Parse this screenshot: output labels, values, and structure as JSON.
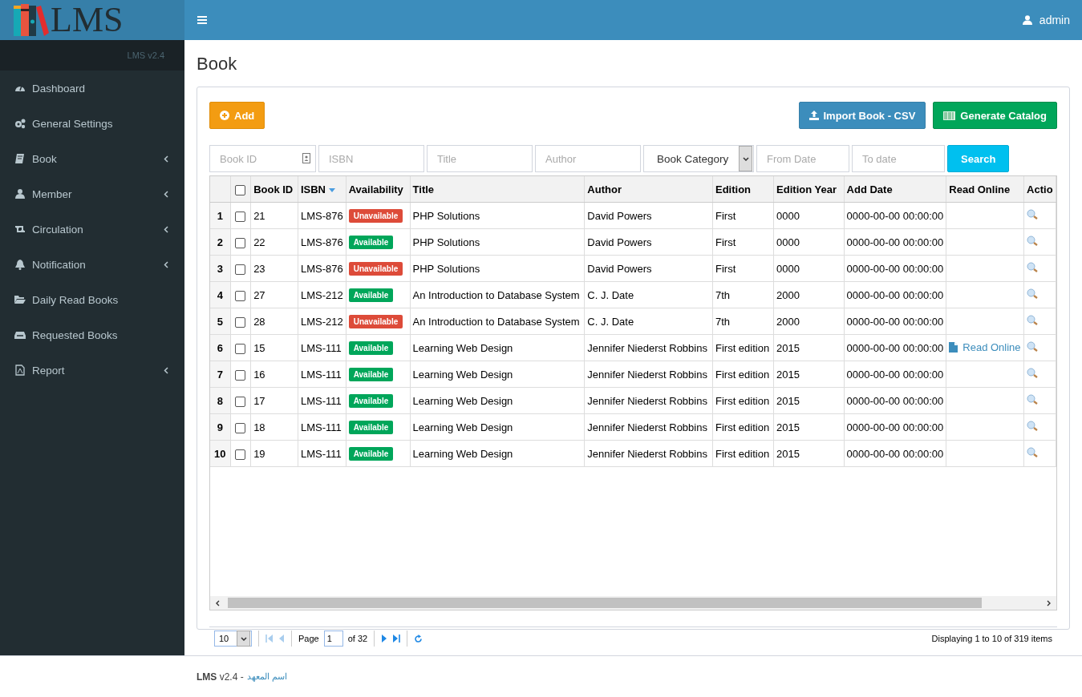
{
  "logo": {
    "text": "LMS"
  },
  "sidebar": {
    "version": "LMS v2.4",
    "items": [
      {
        "label": "Dashboard",
        "has_submenu": false
      },
      {
        "label": "General Settings",
        "has_submenu": false
      },
      {
        "label": "Book",
        "has_submenu": true
      },
      {
        "label": "Member",
        "has_submenu": true
      },
      {
        "label": "Circulation",
        "has_submenu": true
      },
      {
        "label": "Notification",
        "has_submenu": true
      },
      {
        "label": "Daily Read Books",
        "has_submenu": false
      },
      {
        "label": "Requested Books",
        "has_submenu": false
      },
      {
        "label": "Report",
        "has_submenu": true
      }
    ]
  },
  "header": {
    "user": "admin"
  },
  "page_title": "Book",
  "toolbar": {
    "add": "Add",
    "import": "Import Book - CSV",
    "catalog": "Generate Catalog"
  },
  "filters": {
    "book_id": {
      "placeholder": "Book ID"
    },
    "isbn": {
      "placeholder": "ISBN"
    },
    "title": {
      "placeholder": "Title"
    },
    "author": {
      "placeholder": "Author"
    },
    "category": "Book Category",
    "from_date": {
      "placeholder": "From Date"
    },
    "to_date": {
      "placeholder": "To date"
    },
    "search": "Search"
  },
  "table": {
    "header_checked": false,
    "columns": [
      {
        "label": "Book ID",
        "sorted": false
      },
      {
        "label": "ISBN",
        "sorted": true
      },
      {
        "label": "Availability",
        "sorted": false
      },
      {
        "label": "Title",
        "sorted": false
      },
      {
        "label": "Author",
        "sorted": false
      },
      {
        "label": "Edition",
        "sorted": false
      },
      {
        "label": "Edition Year",
        "sorted": false
      },
      {
        "label": "Add Date",
        "sorted": false
      },
      {
        "label": "Read Online",
        "sorted": false
      },
      {
        "label": "Actio",
        "sorted": false
      }
    ],
    "rows": [
      {
        "num": "1",
        "checked": false,
        "book_id": "21",
        "isbn": "LMS-876",
        "availability": {
          "kind": "unavailable",
          "label": "Unavailable"
        },
        "title": "PHP Solutions",
        "author": "David Powers",
        "edition": "First",
        "edition_year": "0000",
        "add_date": "0000-00-00 00:00:00"
      },
      {
        "num": "2",
        "checked": false,
        "book_id": "22",
        "isbn": "LMS-876",
        "availability": {
          "kind": "available",
          "label": "Available"
        },
        "title": "PHP Solutions",
        "author": "David Powers",
        "edition": "First",
        "edition_year": "0000",
        "add_date": "0000-00-00 00:00:00"
      },
      {
        "num": "3",
        "checked": false,
        "book_id": "23",
        "isbn": "LMS-876",
        "availability": {
          "kind": "unavailable",
          "label": "Unavailable"
        },
        "title": "PHP Solutions",
        "author": "David Powers",
        "edition": "First",
        "edition_year": "0000",
        "add_date": "0000-00-00 00:00:00"
      },
      {
        "num": "4",
        "checked": false,
        "book_id": "27",
        "isbn": "LMS-212",
        "availability": {
          "kind": "available",
          "label": "Available"
        },
        "title": "An Introduction to Database System",
        "author": "C. J. Date",
        "edition": "7th",
        "edition_year": "2000",
        "add_date": "0000-00-00 00:00:00"
      },
      {
        "num": "5",
        "checked": false,
        "book_id": "28",
        "isbn": "LMS-212",
        "availability": {
          "kind": "unavailable",
          "label": "Unavailable"
        },
        "title": "An Introduction to Database System",
        "author": "C. J. Date",
        "edition": "7th",
        "edition_year": "2000",
        "add_date": "0000-00-00 00:00:00"
      },
      {
        "num": "6",
        "checked": false,
        "book_id": "15",
        "isbn": "LMS-111",
        "availability": {
          "kind": "available",
          "label": "Available"
        },
        "title": "Learning Web Design",
        "author": "Jennifer Niederst Robbins",
        "edition": "First edition",
        "edition_year": "2015",
        "add_date": "0000-00-00 00:00:00",
        "read_online": "Read Online"
      },
      {
        "num": "7",
        "checked": false,
        "book_id": "16",
        "isbn": "LMS-111",
        "availability": {
          "kind": "available",
          "label": "Available"
        },
        "title": "Learning Web Design",
        "author": "Jennifer Niederst Robbins",
        "edition": "First edition",
        "edition_year": "2015",
        "add_date": "0000-00-00 00:00:00"
      },
      {
        "num": "8",
        "checked": false,
        "book_id": "17",
        "isbn": "LMS-111",
        "availability": {
          "kind": "available",
          "label": "Available"
        },
        "title": "Learning Web Design",
        "author": "Jennifer Niederst Robbins",
        "edition": "First edition",
        "edition_year": "2015",
        "add_date": "0000-00-00 00:00:00"
      },
      {
        "num": "9",
        "checked": false,
        "book_id": "18",
        "isbn": "LMS-111",
        "availability": {
          "kind": "available",
          "label": "Available"
        },
        "title": "Learning Web Design",
        "author": "Jennifer Niederst Robbins",
        "edition": "First edition",
        "edition_year": "2015",
        "add_date": "0000-00-00 00:00:00"
      },
      {
        "num": "10",
        "checked": false,
        "book_id": "19",
        "isbn": "LMS-111",
        "availability": {
          "kind": "available",
          "label": "Available"
        },
        "title": "Learning Web Design",
        "author": "Jennifer Niederst Robbins",
        "edition": "First edition",
        "edition_year": "2015",
        "add_date": "0000-00-00 00:00:00"
      }
    ]
  },
  "pagination": {
    "page_size": "10",
    "page_label": "Page",
    "page": "1",
    "of": "of 32",
    "status": "Displaying 1 to 10 of 319 items"
  },
  "footer": {
    "text": "**LMS** v2.4 -",
    "link": "اسم المعهد"
  }
}
